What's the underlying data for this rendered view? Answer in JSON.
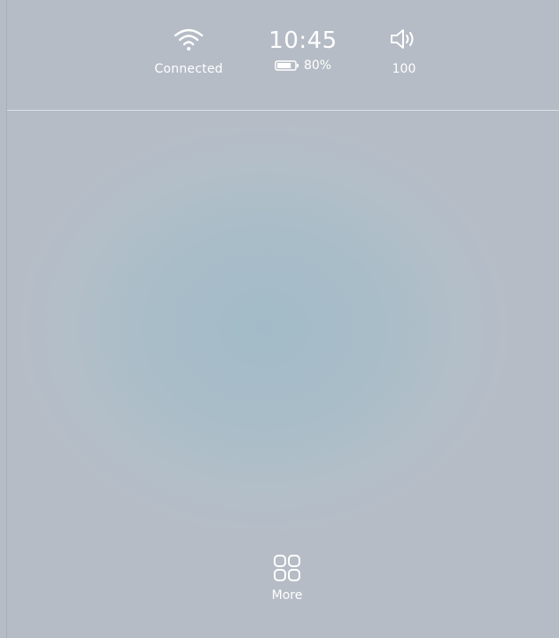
{
  "status": {
    "wifi": {
      "icon": "wifi-icon",
      "label": "Connected"
    },
    "clock": {
      "time": "10:45"
    },
    "battery": {
      "icon": "battery-icon",
      "percent_label": "80%",
      "level": 0.8
    },
    "volume": {
      "icon": "speaker-icon",
      "label": "100"
    }
  },
  "dock": {
    "more": {
      "icon": "grid-icon",
      "label": "More"
    }
  },
  "colors": {
    "background": "#b6bcc6",
    "glow": "#a3bbc8",
    "text": "#ffffff"
  }
}
